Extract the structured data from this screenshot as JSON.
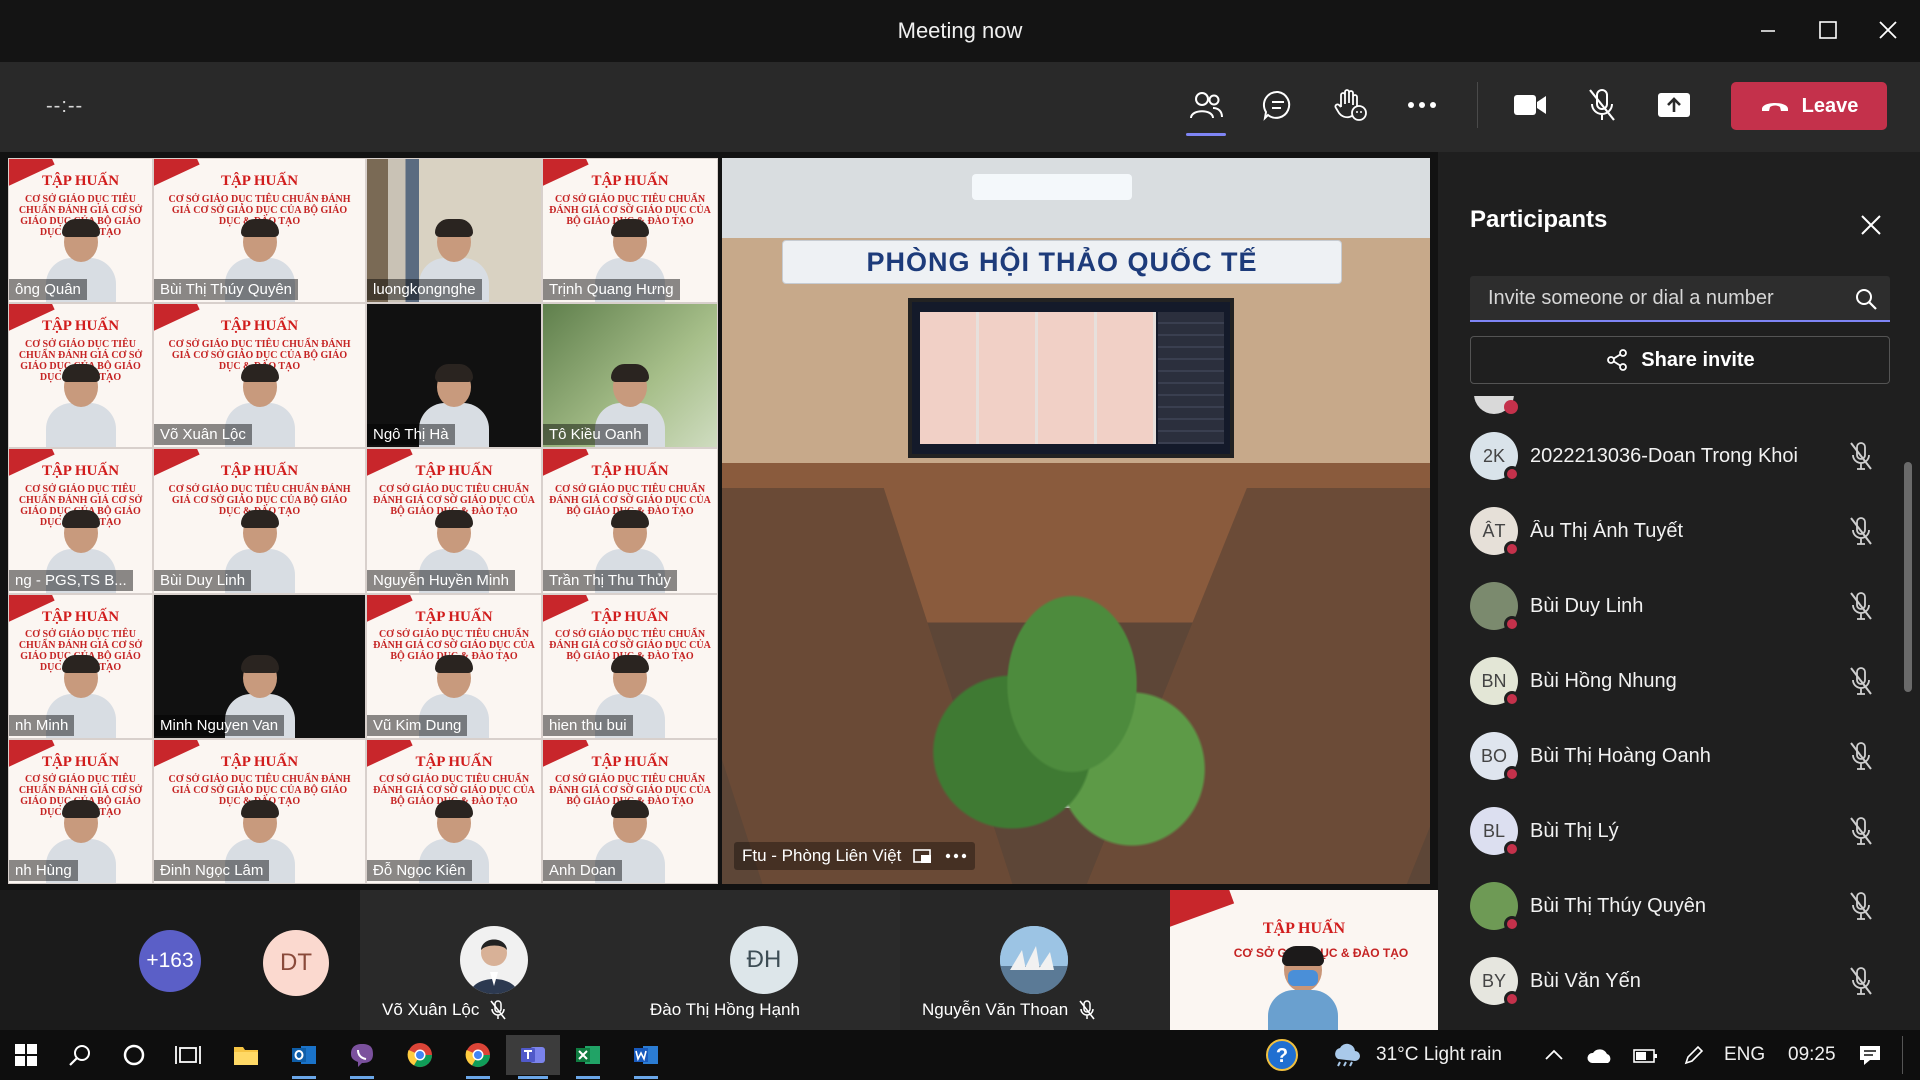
{
  "window": {
    "title": "Meeting now"
  },
  "toolbar": {
    "timer": "--:--",
    "leave_label": "Leave"
  },
  "gallery": {
    "tiles": [
      {
        "name": "ông Quân",
        "banner": "TẬP HUẤN"
      },
      {
        "name": "Bùi Thị Thúy Quyên",
        "banner": "TẬP HUẤN"
      },
      {
        "name": "luongkongnghe",
        "banner": ""
      },
      {
        "name": "Trịnh Quang Hưng",
        "banner": "TẬP HUẤN"
      },
      {
        "name": "",
        "banner": "TẬP HUẤN"
      },
      {
        "name": "Võ Xuân Lộc",
        "banner": "TẬP HUẤN"
      },
      {
        "name": "Ngô Thị Hà",
        "banner": ""
      },
      {
        "name": "Tô Kiều Oanh",
        "banner": ""
      },
      {
        "name": "ng - PGS,TS B...",
        "banner": "TẬP HUẤN"
      },
      {
        "name": "Bùi Duy Linh",
        "banner": "TẬP HUẤN"
      },
      {
        "name": "Nguyễn Huyền Minh",
        "banner": "TẬP HUẤN"
      },
      {
        "name": "Trần Thị Thu Thủy",
        "banner": "TẬP HUẤN"
      },
      {
        "name": "nh Minh",
        "banner": "TẬP HUẤN"
      },
      {
        "name": "Minh Nguyen Van",
        "banner": ""
      },
      {
        "name": "Vũ Kim Dung",
        "banner": "TẬP HUẤN"
      },
      {
        "name": "hien thu bui",
        "banner": "TẬP HUẤN"
      },
      {
        "name": "nh Hùng",
        "banner": "TẬP HUẤN"
      },
      {
        "name": "Đinh Ngọc Lâm",
        "banner": "TẬP HUẤN"
      },
      {
        "name": "Đỗ Ngọc Kiên",
        "banner": "TẬP HUẤN"
      },
      {
        "name": "Anh Doan",
        "banner": "TẬP HUẤN"
      }
    ],
    "banner_sub": "CƠ SỞ GIÁO DỤC TIÊU CHUẨN ĐÁNH GIÁ CƠ SỞ GIÁO DỤC CỦA BỘ GIÁO DỤC & ĐÀO TẠO"
  },
  "room": {
    "sign": "PHÒNG HỘI THẢO QUỐC TẾ",
    "label": "Ftu - Phòng Liên Việt"
  },
  "strip": {
    "overflow_count": "+163",
    "dt_initials": "DT",
    "people": [
      {
        "name": "Võ Xuân Lộc"
      },
      {
        "name": "Đào Thị Hồng Hạnh",
        "initials": "ĐH"
      },
      {
        "name": "Nguyễn Văn Thoan"
      }
    ],
    "video_banner": "TẬP HUẤN",
    "video_sub": "CƠ SỞ GIÁO DỤC & ĐÀO TẠO"
  },
  "panel": {
    "title": "Participants",
    "invite_placeholder": "Invite someone or dial a number",
    "share_label": "Share invite",
    "participants": [
      {
        "initials": "2K",
        "name": "2022213036-Doan Trong Khoi",
        "color": "#d9e3ea"
      },
      {
        "initials": "ÂT",
        "name": "Âu Thị Ánh Tuyết",
        "color": "#e6e0d8"
      },
      {
        "initials": "",
        "name": "Bùi Duy Linh",
        "color": "#7b8a6e"
      },
      {
        "initials": "BN",
        "name": "Bùi Hồng Nhung",
        "color": "#e3e6d6"
      },
      {
        "initials": "BO",
        "name": "Bùi Thị Hoàng Oanh",
        "color": "#dfe5ee"
      },
      {
        "initials": "BL",
        "name": "Bùi Thị Lý",
        "color": "#dcdff0"
      },
      {
        "initials": "",
        "name": "Bùi Thị Thúy Quyên",
        "color": "#6e9a55"
      },
      {
        "initials": "BY",
        "name": "Bùi Văn Yến",
        "color": "#e6e6df"
      }
    ]
  },
  "taskbar": {
    "weather": "31°C  Light rain",
    "lang": "ENG",
    "time": "09:25"
  },
  "colors": {
    "accent": "#7f85f5",
    "leave": "#c4314b",
    "status_busy": "#c4314b"
  }
}
